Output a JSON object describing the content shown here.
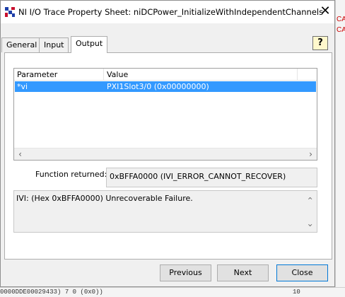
{
  "window": {
    "title": "NI I/O Trace Property Sheet: niDCPower_InitializeWithIndependentChannels",
    "icon": "ni-trace-app-icon",
    "close_glyph": "✕"
  },
  "tabs": [
    {
      "label": "General",
      "active": false
    },
    {
      "label": "Input",
      "active": false
    },
    {
      "label": "Output",
      "active": true
    }
  ],
  "help_button": {
    "label": "?",
    "icon": "help-question-icon"
  },
  "output_table": {
    "columns": [
      "Parameter",
      "Value"
    ],
    "rows": [
      {
        "parameter": "*vi",
        "value": "PXI1Slot3/0 (0x00000000)",
        "selected": true
      }
    ]
  },
  "function_returned": {
    "label": "Function returned:",
    "value": "0xBFFA0000 (IVI_ERROR_CANNOT_RECOVER)"
  },
  "description": "IVI: (Hex 0xBFFA0000) Unrecoverable Failure.",
  "buttons": {
    "previous": "Previous",
    "next": "Next",
    "close": "Close"
  },
  "background": {
    "right_fragments": [
      "CA",
      "CA"
    ],
    "bottom_left": "0000DDE00029433) 7 0 (0x0))",
    "bottom_right": "10"
  },
  "colors": {
    "selection": "#3399ff",
    "default_button_border": "#0078d7"
  }
}
